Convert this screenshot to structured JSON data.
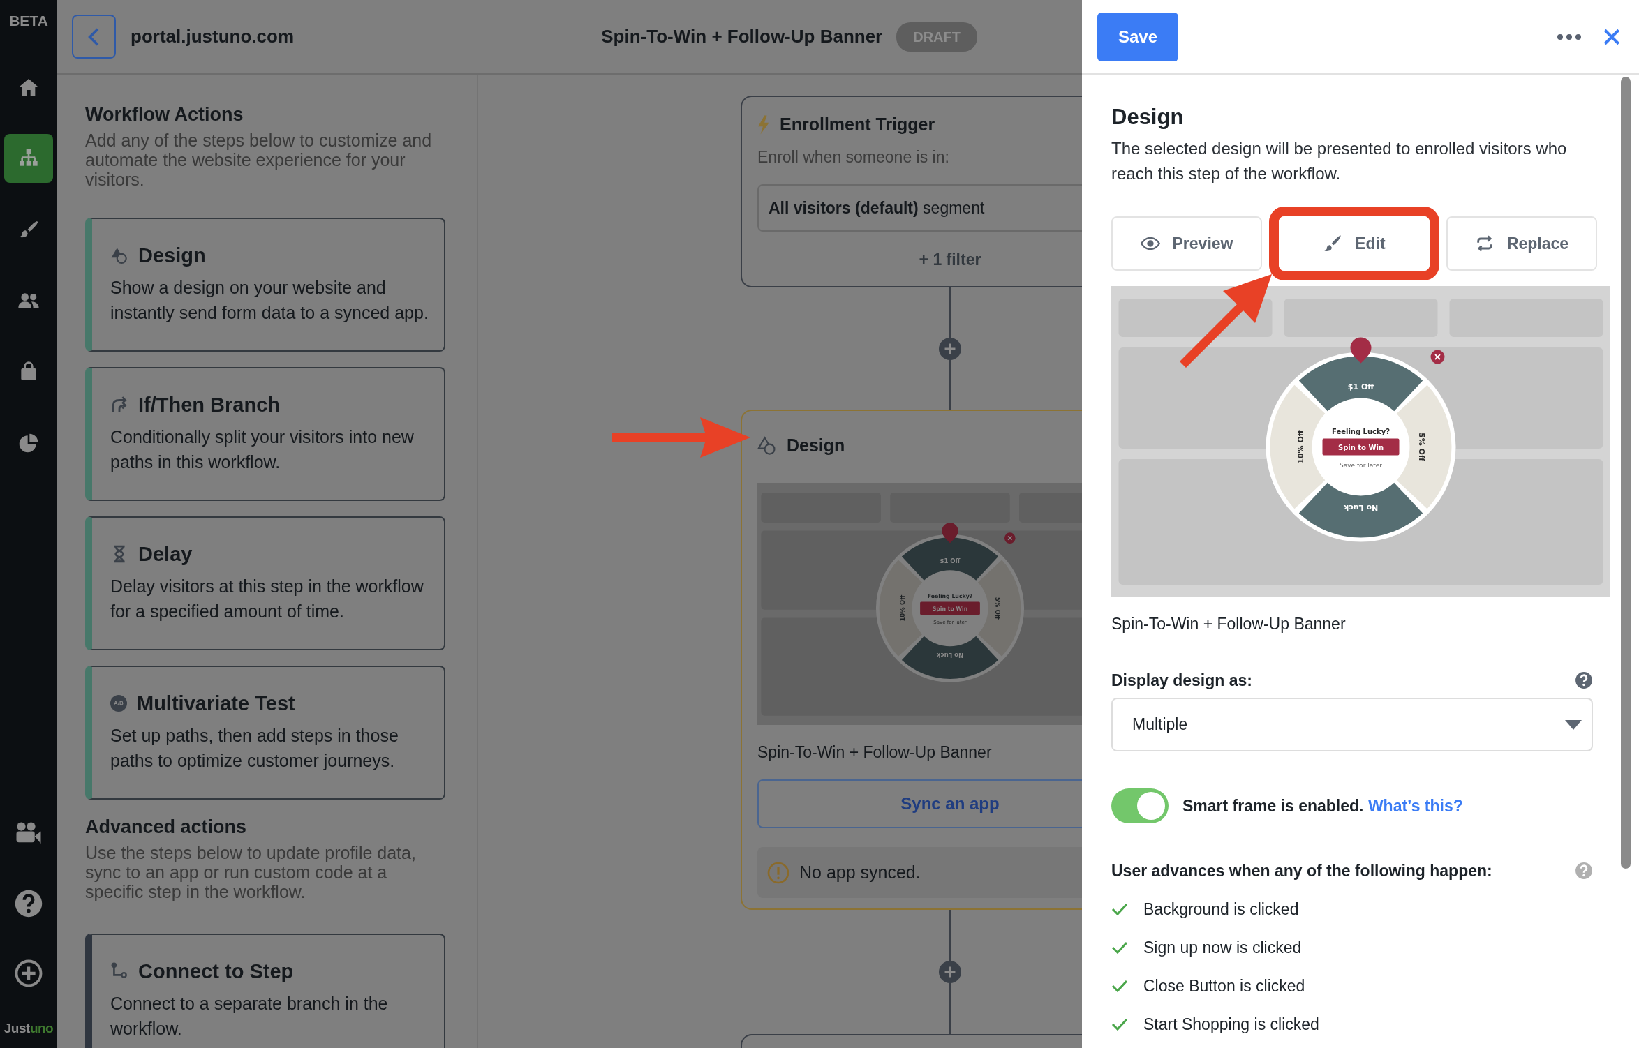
{
  "sidebar": {
    "badge": "BETA",
    "items": [
      {
        "selected": false
      },
      {
        "selected": true
      },
      {
        "selected": false
      },
      {
        "selected": false
      },
      {
        "selected": false
      },
      {
        "selected": false
      }
    ],
    "bottom_items": [
      {
        "selected": false
      },
      {
        "selected": false
      },
      {
        "selected": false
      }
    ],
    "logo": {
      "text": "Just",
      "accent": "uno"
    }
  },
  "topbar": {
    "domain": "portal.justuno.com",
    "title": "Spin-To-Win + Follow-Up Banner",
    "status": "DRAFT"
  },
  "actions_panel": {
    "title": "Workflow Actions",
    "description": "Add any of the steps below to customize and automate the website experience for your visitors.",
    "actions": [
      {
        "title": "Design",
        "description": "Show a design on your website and instantly send form data to a synced app.",
        "color": "#47786a"
      },
      {
        "title": "If/Then Branch",
        "description": "Conditionally split your visitors into new paths in this workflow.",
        "color": "#47786a"
      },
      {
        "title": "Delay",
        "description": "Delay visitors at this step in the workflow for a specified amount of time.",
        "color": "#47786a"
      },
      {
        "title": "Multivariate Test",
        "description": "Set up paths, then add steps in those paths to optimize customer journeys.",
        "color": "#47786a",
        "icon_text": "A/B"
      }
    ],
    "advanced_title": "Advanced actions",
    "advanced_description": "Use the steps below to update profile data, sync to an app or run custom code at a specific step in the workflow.",
    "advanced_actions": [
      {
        "title": "Connect to Step",
        "description": "Connect to a separate branch in the workflow.",
        "color": "#2f3640"
      }
    ]
  },
  "canvas": {
    "trigger": {
      "title": "Enrollment Trigger",
      "label": "Enroll when someone is in:",
      "segment": "**All visitors (default)** segment",
      "filter": "+ 1 filter"
    },
    "design_step": {
      "title": "Design",
      "preview": {
        "segments": [
          {
            "label": "$1 Off",
            "color": "#2b373a"
          },
          {
            "label": "5% Off",
            "color": "#74726e"
          },
          {
            "label": "No Luck",
            "color": "#2b373a"
          },
          {
            "label": "10% Off",
            "color": "#74726e"
          }
        ],
        "headline": "Feeling Lucky?",
        "button": "Spin to Win",
        "link": "Save for later"
      },
      "caption": "Spin-To-Win + Follow-Up Banner",
      "sync_button": "Sync an app",
      "notice": "No app synced."
    }
  },
  "design_panel": {
    "save": "Save",
    "title": "Design",
    "description": "The selected design will be presented to enrolled visitors who reach this step of the workflow.",
    "buttons": [
      {
        "label": "Preview",
        "highlighted": false
      },
      {
        "label": "Edit",
        "highlighted": true
      },
      {
        "label": "Replace",
        "highlighted": false
      }
    ],
    "preview": {
      "segments": [
        {
          "label": "$1 Off",
          "color": "#566e72"
        },
        {
          "label": "5% Off",
          "color": "#e8e5dc"
        },
        {
          "label": "No Luck",
          "color": "#566e72"
        },
        {
          "label": "10% Off",
          "color": "#e8e5dc"
        }
      ],
      "headline": "Feeling Lucky?",
      "button": "Spin to Win",
      "link": "Save for later"
    },
    "caption": "Spin-To-Win + Follow-Up Banner",
    "display_label": "Display design as:",
    "display_value": "Multiple",
    "smart_frame": {
      "on": true,
      "text": "Smart frame is enabled.",
      "link": "What’s this?"
    },
    "advance_title": "User advances when any of the following happen:",
    "advance_conditions": [
      {
        "label": "Background is clicked",
        "checked": true
      },
      {
        "label": "Sign up now is clicked",
        "checked": true
      },
      {
        "label": "Close Button is clicked",
        "checked": true
      },
      {
        "label": "Start Shopping is clicked",
        "checked": true
      }
    ]
  }
}
